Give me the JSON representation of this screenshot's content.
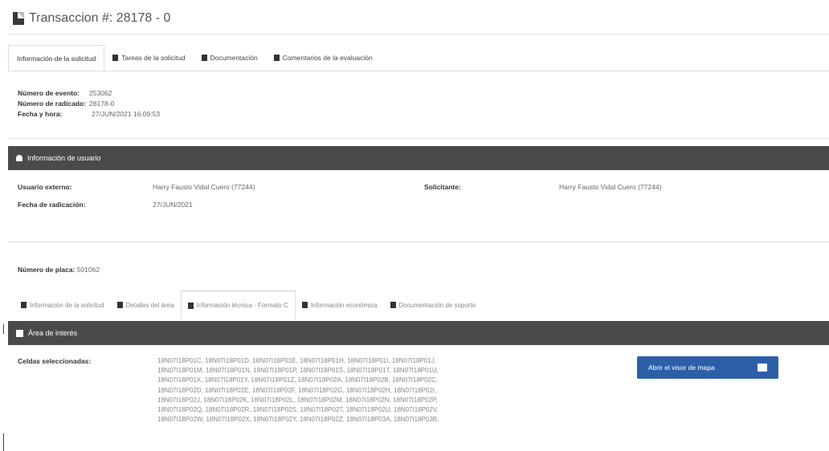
{
  "header": {
    "title": "Transaccion #: 28178 - 0"
  },
  "tabs": [
    {
      "label": "Información de la solicitud"
    },
    {
      "label": "Tareas de la solicitud"
    },
    {
      "label": "Documentación"
    },
    {
      "label": "Comentarios de la evaluación"
    }
  ],
  "meta": {
    "evento_label": "Número de evento:",
    "evento_value": "253062",
    "radicado_label": "Número de radicado:",
    "radicado_value": "28178-0",
    "fecha_label": "Fecha y hora:",
    "fecha_value": "27/JUN/2021 16:09:53"
  },
  "user_section": {
    "title": "Información de usuario",
    "usuario_externo_label": "Usuario externo:",
    "usuario_externo_value": "Harry Fausto Vidal Cuero (77244)",
    "solicitante_label": "Solicitante:",
    "solicitante_value": "Harry Fausto Vidal Cuero (77244)",
    "fecha_radicacion_label": "Fecha de radicación:",
    "fecha_radicacion_value": "27/JUN/2021"
  },
  "placa": {
    "label": "Número de placa:",
    "value": "501062"
  },
  "subtabs": [
    {
      "label": "Información de la solicitud"
    },
    {
      "label": "Detalles del área"
    },
    {
      "label": "Información técnica - Formato C"
    },
    {
      "label": "Información económica"
    },
    {
      "label": "Documentación de soporte"
    }
  ],
  "area_section": {
    "title": "Área de interés",
    "cells_label": "Celdas seleccionadas:",
    "cells_lines": [
      "18N07I18P01C, 18N07I18P01D, 18N07I18P01E, 18N07I18P01H, 18N07I18P01I, 18N07I18P01J,",
      "18N07I18P01M, 18N07I18P01N, 18N07I18P01P, 18N07I18P01S, 18N07I18P01T, 18N07I18P01U,",
      "18N07I18P01X, 18N07I18P01Y, 18N07I18P01Z, 18N07I18P02A, 18N07I18P02B, 18N07I18P02C,",
      "18N07I18P02D, 18N07I18P02E, 18N07I18P02F, 18N07I18P02G, 18N07I18P02H, 18N07I18P02I,",
      "18N07I18P02J, 18N07I18P02K, 18N07I18P02L, 18N07I18P02M, 18N07I18P02N, 18N07I18P02P,",
      "18N07I18P02Q, 18N07I18P02R, 18N07I18P02S, 18N07I18P02T, 18N07I18P02U, 18N07I18P02V,",
      "18N07I18P02W, 18N07I18P02X, 18N07I18P02Y, 18N07I18P02Z, 18N07I18P03A, 18N07I18P03B,"
    ],
    "map_button_label": "Abrir el visor de mapa"
  }
}
